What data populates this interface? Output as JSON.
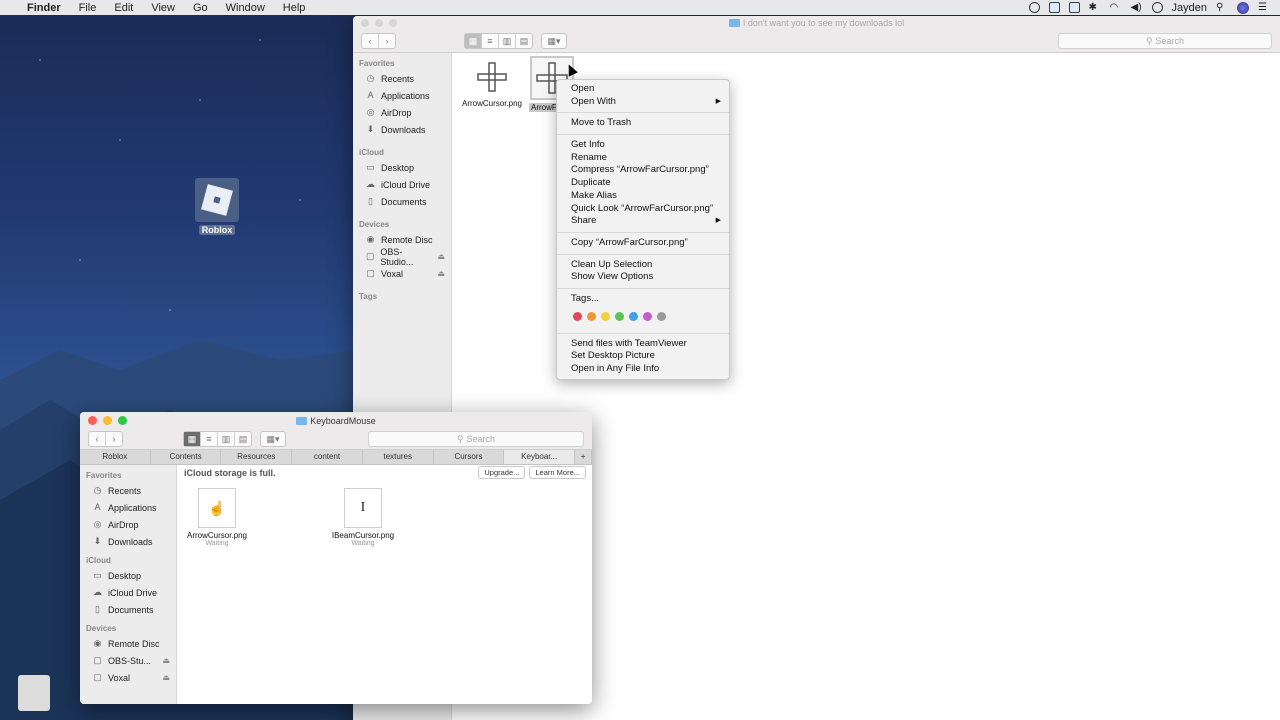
{
  "menubar": {
    "items": [
      "Finder",
      "File",
      "Edit",
      "View",
      "Go",
      "Window",
      "Help"
    ],
    "user": "Jayden"
  },
  "desktop": {
    "icon_label": "Roblox"
  },
  "main_window": {
    "title": "I don't want you to see my downloads lol",
    "search_placeholder": "Search",
    "sidebar": {
      "favorites_header": "Favorites",
      "favorites": [
        "Recents",
        "Applications",
        "AirDrop",
        "Downloads"
      ],
      "icloud_header": "iCloud",
      "icloud": [
        "Desktop",
        "iCloud Drive",
        "Documents"
      ],
      "devices_header": "Devices",
      "devices": [
        "Remote Disc",
        "OBS-Studio...",
        "Voxal"
      ],
      "tags_header": "Tags"
    },
    "files": [
      "ArrowCursor.png",
      "ArrowF"
    ]
  },
  "context_menu": {
    "open": "Open",
    "open_with": "Open With",
    "move_to_trash": "Move to Trash",
    "get_info": "Get Info",
    "rename": "Rename",
    "compress": "Compress “ArrowFarCursor.png”",
    "duplicate": "Duplicate",
    "make_alias": "Make Alias",
    "quick_look": "Quick Look “ArrowFarCursor.png”",
    "share": "Share",
    "copy": "Copy “ArrowFarCursor.png”",
    "clean_up": "Clean Up Selection",
    "view_options": "Show View Options",
    "tags": "Tags...",
    "tag_colors": [
      "#e2475b",
      "#f0953a",
      "#f3cf3c",
      "#5bc35a",
      "#3ea2e6",
      "#c45ccf",
      "#9a9a9a"
    ],
    "teamviewer": "Send files with TeamViewer",
    "desktop_picture": "Set Desktop Picture",
    "any_file_info": "Open in Any File Info"
  },
  "kb_window": {
    "title": "KeyboardMouse",
    "search_placeholder": "Search",
    "tabs": [
      "Roblox",
      "Contents",
      "Resources",
      "content",
      "textures",
      "Cursors",
      "Keyboar..."
    ],
    "storage_msg": "iCloud storage is full.",
    "upgrade": "Upgrade...",
    "learn_more": "Learn More...",
    "sidebar": {
      "favorites_header": "Favorites",
      "favorites": [
        "Recents",
        "Applications",
        "AirDrop",
        "Downloads"
      ],
      "icloud_header": "iCloud",
      "icloud": [
        "Desktop",
        "iCloud Drive",
        "Documents"
      ],
      "devices_header": "Devices",
      "devices": [
        "Remote Disc",
        "OBS-Stu...",
        "Voxal"
      ]
    },
    "files": [
      {
        "name": "ArrowCursor.png",
        "status": "Waiting"
      },
      {
        "name": "IBeamCursor.png",
        "status": "Waiting"
      }
    ]
  }
}
